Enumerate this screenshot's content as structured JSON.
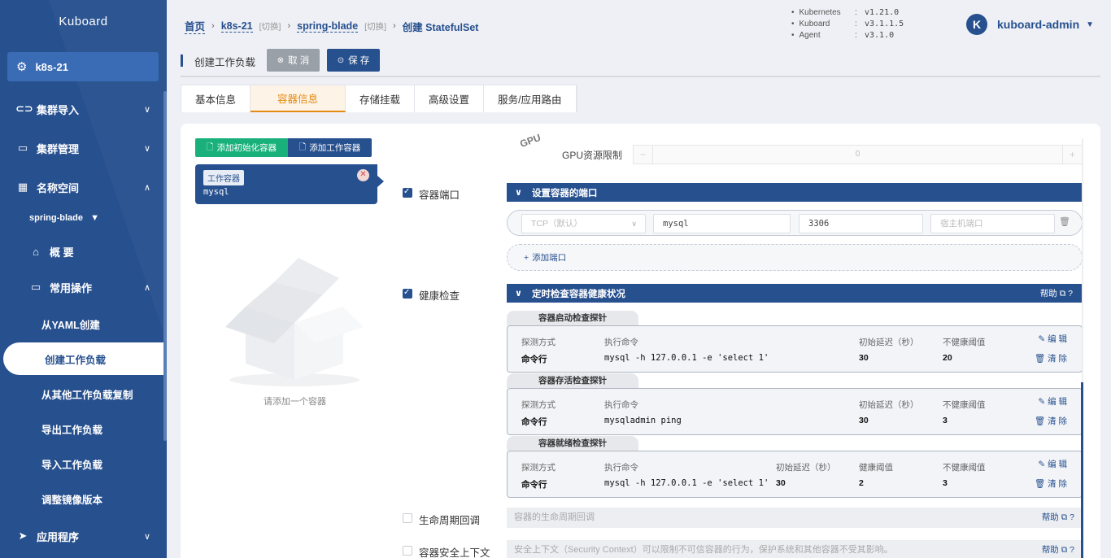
{
  "app": {
    "brand": "Kuboard"
  },
  "sidebar": {
    "cluster": "k8s-21",
    "items": [
      {
        "label": "集群导入"
      },
      {
        "label": "集群管理"
      },
      {
        "label": "名称空间"
      }
    ],
    "namespace": "spring-blade",
    "overview": "概 要",
    "common_ops": "常用操作",
    "sub_items": [
      {
        "label": "从YAML创建"
      },
      {
        "label": "创建工作负载"
      },
      {
        "label": "从其他工作负载复制"
      },
      {
        "label": "导出工作负载"
      },
      {
        "label": "导入工作负载"
      },
      {
        "label": "调整镜像版本"
      }
    ],
    "apps": "应用程序"
  },
  "breadcrumb": {
    "home": "首页",
    "cluster": "k8s-21",
    "switch1": "[切换]",
    "namespace": "spring-blade",
    "switch2": "[切换]",
    "current": "创建 StatefulSet"
  },
  "versions": [
    {
      "name": "Kubernetes",
      "value": "v1.21.0"
    },
    {
      "name": "Kuboard",
      "value": "v3.1.1.5"
    },
    {
      "name": "Agent",
      "value": "v3.1.0"
    }
  ],
  "user": {
    "initial": "K",
    "name": "kuboard-admin"
  },
  "titlebar": {
    "title": "创建工作负载",
    "cancel": "取 消",
    "save": "保 存"
  },
  "tabs": [
    "基本信息",
    "容器信息",
    "存储挂载",
    "高级设置",
    "服务/应用路由"
  ],
  "left": {
    "add_init": "添加初始化容器",
    "add_work": "添加工作容器",
    "card_badge": "工作容器",
    "card_name": "mysql",
    "empty_text": "请添加一个容器"
  },
  "gpu": {
    "label": "GPU资源限制",
    "value": "0"
  },
  "ports": {
    "label": "容器端口",
    "bar": "设置容器的端口",
    "protocol_placeholder": "TCP（默认）",
    "name": "mysql",
    "port": "3306",
    "host_placeholder": "宿主机端口",
    "add": "添加端口"
  },
  "health": {
    "label": "健康检查",
    "bar": "定时检查容器健康状况",
    "help": "帮助",
    "startup_title": "容器启动检查探针",
    "liveness_title": "容器存活检查探针",
    "readiness_title": "容器就绪检查探针",
    "h_method": "探测方式",
    "h_cmd": "执行命令",
    "h_delay": "初始延迟（秒）",
    "h_unhealthy": "不健康阈值",
    "h_healthy": "健康阈值",
    "edit": "编 辑",
    "clear": "清 除",
    "startup": {
      "method": "命令行",
      "cmd": "mysql -h 127.0.0.1 -e 'select 1'",
      "delay": "30",
      "unhealthy": "20"
    },
    "liveness": {
      "method": "命令行",
      "cmd": "mysqladmin ping",
      "delay": "30",
      "unhealthy": "3"
    },
    "readiness": {
      "method": "命令行",
      "cmd": "mysql -h 127.0.0.1 -e 'select 1'",
      "delay": "30",
      "healthy": "2",
      "unhealthy": "3"
    }
  },
  "lifecycle": {
    "label": "生命周期回调",
    "placeholder": "容器的生命周期回调",
    "help": "帮助"
  },
  "security": {
    "label": "容器安全上下文",
    "placeholder": "安全上下文（Security Context）可以限制不可信容器的行为，保护系统和其他容器不受其影响。",
    "help": "帮助"
  }
}
